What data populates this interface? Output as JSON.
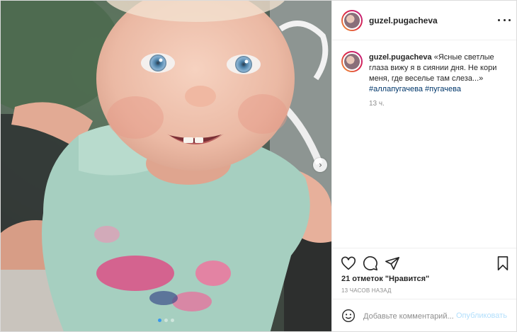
{
  "post": {
    "username": "guzel.pugacheva",
    "caption_username": "guzel.pugacheva",
    "caption_text": "«Ясные светлые глаза вижу я в сиянии дня. Не кори меня, где веселье там слеза...»",
    "hashtags": [
      "#аллапугачева",
      "#пугачева"
    ],
    "relative_time": "13 ч.",
    "likes_text": "21 отметок \"Нравится\"",
    "posted_ago": "13 ЧАСОВ НАЗАД"
  },
  "media": {
    "carousel_dots": 3,
    "active_dot": 1
  },
  "comment": {
    "placeholder": "Добавьте комментарий...",
    "publish_label": "Опубликовать"
  },
  "icons": {
    "header_menu": "more-horizontal-icon",
    "like": "heart-icon",
    "comment": "speech-bubble-icon",
    "share": "paper-plane-icon",
    "save": "bookmark-icon",
    "emoji": "smiley-icon",
    "next": "chevron-right-icon"
  },
  "colors": {
    "link": "#00376b",
    "publish_disabled": "#b2dffc",
    "active_dot": "#3897f0",
    "muted": "#8e8e8e"
  }
}
